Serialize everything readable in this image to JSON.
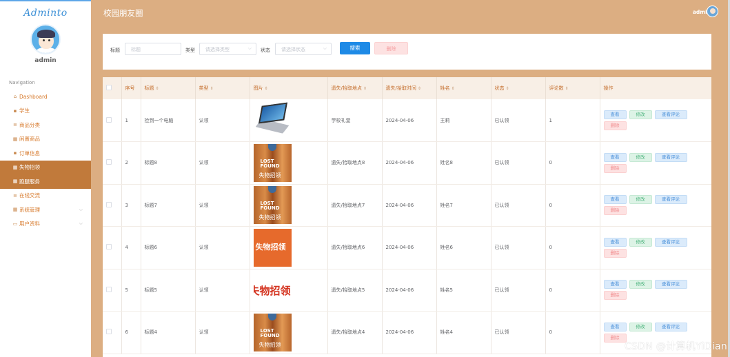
{
  "sidebar": {
    "logo": "Adminto",
    "user_name": "admin",
    "nav_title": "Navigation",
    "items": [
      {
        "label": "Dashboard",
        "icon": "home-icon"
      },
      {
        "label": "学生",
        "icon": "clipboard-icon"
      },
      {
        "label": "商品分类",
        "icon": "list-icon"
      },
      {
        "label": "闲置商品",
        "icon": "grid-icon"
      },
      {
        "label": "订单信息",
        "icon": "clipboard-icon"
      },
      {
        "label": "失物招领",
        "icon": "grid-icon",
        "active": true
      },
      {
        "label": "跑腿服务",
        "icon": "grid-icon",
        "active": true
      },
      {
        "label": "在线交流",
        "icon": "list-icon"
      },
      {
        "label": "系统管理",
        "icon": "grid-icon",
        "has_children": true
      },
      {
        "label": "用户资料",
        "icon": "card-icon",
        "has_children": true
      }
    ]
  },
  "header": {
    "title": "校园朋友圈",
    "user": "admin"
  },
  "search": {
    "title_label": "标题",
    "title_placeholder": "标题",
    "type_label": "类型",
    "type_placeholder": "请选择类型",
    "status_label": "状态",
    "status_placeholder": "请选择状态",
    "search_button": "搜索",
    "delete_button": "删除"
  },
  "table": {
    "headers": [
      "序号",
      "标题",
      "类型",
      "图片",
      "遗失/拾取地点",
      "遗失/拾取时间",
      "姓名",
      "状态",
      "评论数",
      "操作"
    ],
    "ops": {
      "view": "查看",
      "edit": "修改",
      "comments": "查看评论",
      "delete": "删除"
    },
    "rows": [
      {
        "index": "1",
        "title": "捡到一个电脑",
        "type": "认领",
        "image": "laptop",
        "place": "学校礼堂",
        "time": "2024-04-06",
        "name": "王莉",
        "status": "已认领",
        "comments": "1"
      },
      {
        "index": "2",
        "title": "标题8",
        "type": "认领",
        "image": "lost-found-sign",
        "place": "遗失/拾取地点8",
        "time": "2024-04-06",
        "name": "姓名8",
        "status": "已认领",
        "comments": "0"
      },
      {
        "index": "3",
        "title": "标题7",
        "type": "认领",
        "image": "lost-found-sign",
        "place": "遗失/拾取地点7",
        "time": "2024-04-06",
        "name": "姓名7",
        "status": "已认领",
        "comments": "0"
      },
      {
        "index": "4",
        "title": "标题6",
        "type": "认领",
        "image": "orange-sign",
        "place": "遗失/拾取地点6",
        "time": "2024-04-06",
        "name": "姓名6",
        "status": "已认领",
        "comments": "0"
      },
      {
        "index": "5",
        "title": "标题5",
        "type": "认领",
        "image": "red-text-sign",
        "place": "遗失/拾取地点5",
        "time": "2024-04-06",
        "name": "姓名5",
        "status": "已认领",
        "comments": "0"
      },
      {
        "index": "6",
        "title": "标题4",
        "type": "认领",
        "image": "lost-found-sign",
        "place": "遗失/拾取地点4",
        "time": "2024-04-06",
        "name": "姓名4",
        "status": "已认领",
        "comments": "0"
      }
    ]
  },
  "image_text": {
    "lost_found_en": "LOST\nFOUND",
    "lost_found_cn": "失物招领",
    "orange_cn": "失物招领",
    "red_cn": "失物招领"
  },
  "watermark": "CSDN @计算机YiDian",
  "colors": {
    "accent": "#dcae82",
    "active_nav": "#c17a3b",
    "primary": "#1e8ae6"
  }
}
